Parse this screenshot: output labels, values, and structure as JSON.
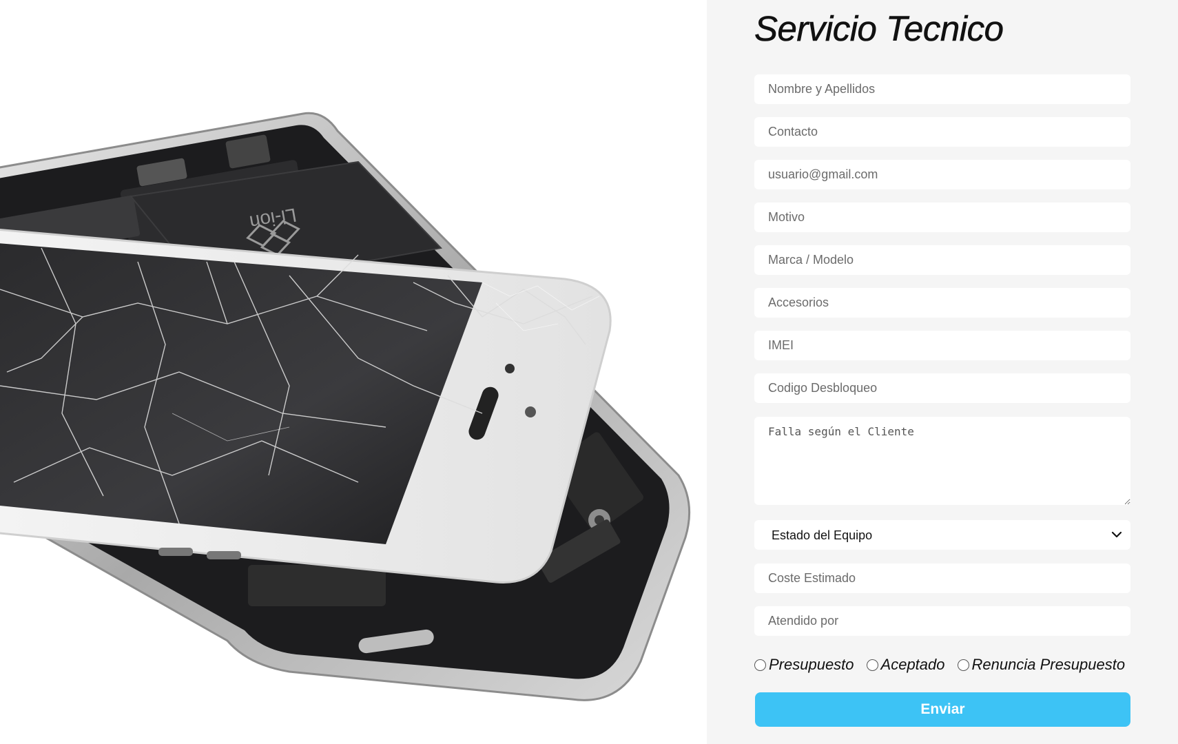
{
  "form": {
    "title": "Servicio Tecnico",
    "fields": {
      "name": "Nombre y Apellidos",
      "contact": "Contacto",
      "email": "usuario@gmail.com",
      "reason": "Motivo",
      "brand_model": "Marca / Modelo",
      "accessories": "Accesorios",
      "imei": "IMEI",
      "unlock_code": "Codigo Desbloqueo",
      "fault": "Falla según el Cliente",
      "estimated_cost": "Coste Estimado",
      "attended_by": "Atendido por"
    },
    "status_select": {
      "selected": "Estado del Equipo"
    },
    "radios": {
      "budget": "Presupuesto",
      "accepted": "Aceptado",
      "declined": "Renuncia Presupuesto"
    },
    "submit_label": "Enviar"
  },
  "image": {
    "subject": "broken-smartphone-photo",
    "battery_text": "Li-ion"
  },
  "colors": {
    "accent": "#3dc3f5",
    "panel_bg": "#f5f5f5",
    "field_bg": "#ffffff"
  }
}
